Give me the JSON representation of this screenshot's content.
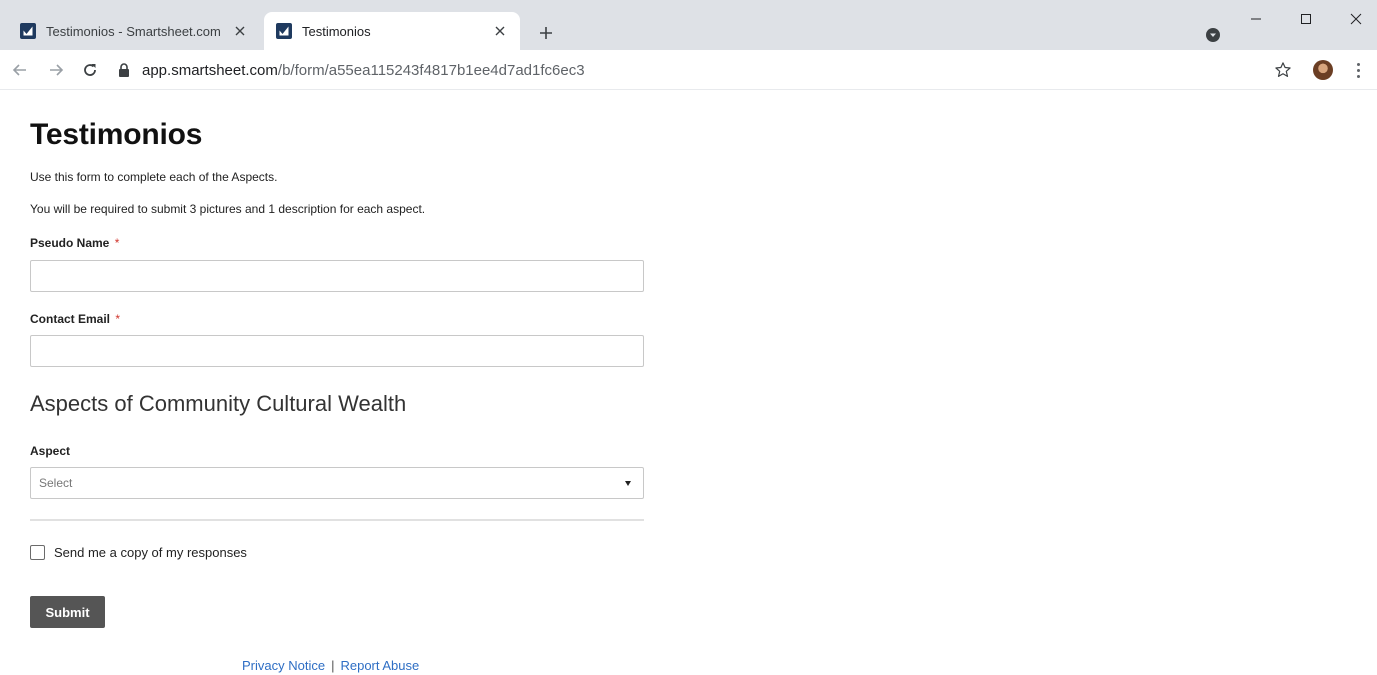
{
  "browser": {
    "tabs": [
      {
        "title": "Testimonios - Smartsheet.com",
        "active": false
      },
      {
        "title": "Testimonios",
        "active": true
      }
    ],
    "url_host": "app.smartsheet.com",
    "url_path": "/b/form/a55ea115243f4817b1ee4d7ad1fc6ec3"
  },
  "form": {
    "title": "Testimonios",
    "description_1": "Use this form to complete each of the Aspects.",
    "description_2": "You will be required to submit 3 pictures and 1 description for each aspect.",
    "fields": {
      "pseudo_name": {
        "label": "Pseudo Name",
        "required_mark": "*",
        "value": ""
      },
      "contact_email": {
        "label": "Contact Email",
        "required_mark": "*",
        "value": ""
      }
    },
    "section_title": "Aspects of Community Cultural Wealth",
    "aspect": {
      "label": "Aspect",
      "selected": "Select"
    },
    "copy_checkbox": {
      "label": "Send me a copy of my responses",
      "checked": false
    },
    "submit_label": "Submit"
  },
  "footer": {
    "privacy_link": "Privacy Notice",
    "separator": "|",
    "abuse_link": "Report Abuse"
  },
  "colors": {
    "tabstrip_bg": "#dee1e6",
    "required_star": "#d0342c",
    "submit_bg": "#555555",
    "link": "#2e6ec4"
  },
  "icons": [
    "smartsheet-favicon",
    "close-icon",
    "plus-icon",
    "extension-icon",
    "minimize-icon",
    "maximize-icon",
    "window-close-icon",
    "back-arrow-icon",
    "forward-arrow-icon",
    "reload-icon",
    "lock-icon",
    "star-icon",
    "profile-avatar",
    "more-vert-icon",
    "chevron-down-icon"
  ]
}
